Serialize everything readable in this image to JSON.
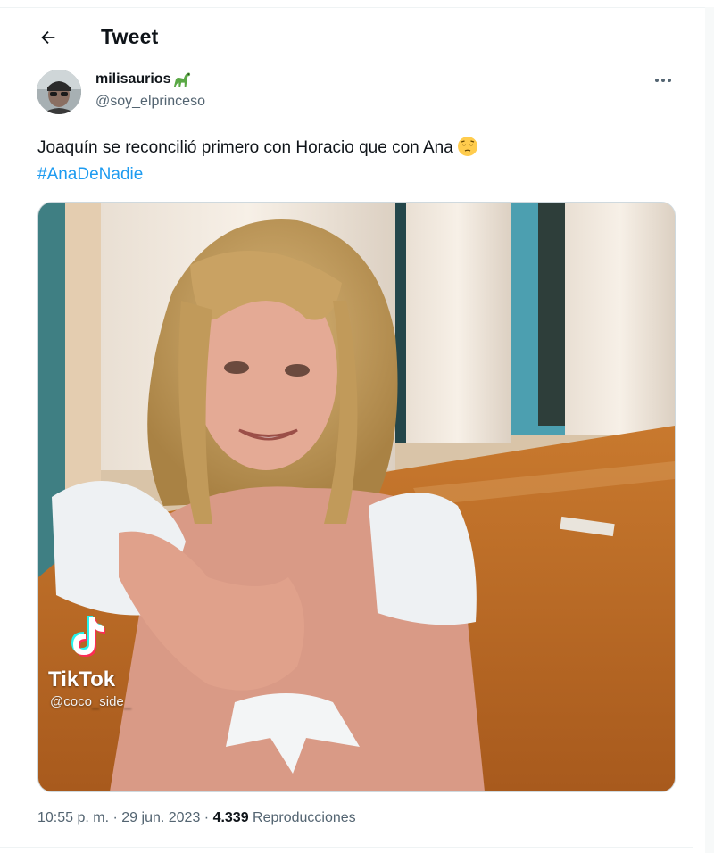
{
  "header": {
    "title": "Tweet"
  },
  "author": {
    "name": "milisaurios",
    "handle": "@soy_elprinceso"
  },
  "tweet": {
    "text": "Joaquín se reconcilió primero con Horacio que con Ana",
    "hashtag": "#AnaDeNadie"
  },
  "media": {
    "watermark_brand": "TikTok",
    "watermark_handle": "@coco_side_"
  },
  "meta": {
    "time": "10:55 p. m.",
    "separator1": " · ",
    "date": "29 jun. 2023",
    "separator2": " · ",
    "views": "4.339",
    "views_label": " Reproducciones"
  },
  "icons": {
    "back": "arrow-left-icon",
    "more": "more-horizontal-icon",
    "name_emoji": "dinosaur-emoji-icon",
    "text_emoji": "pensive-face-emoji-icon"
  },
  "colors": {
    "link": "#1d9bf0",
    "secondary_text": "#536471",
    "primary_text": "#0f1419"
  }
}
